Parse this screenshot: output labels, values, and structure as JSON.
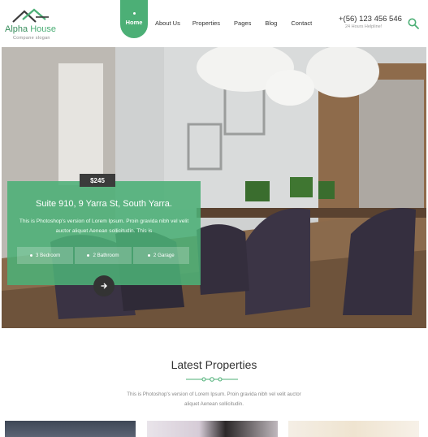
{
  "brand": {
    "name_part1": "Alpha",
    "name_part2": " House",
    "slogan": "Compane slogan"
  },
  "nav": {
    "items": [
      {
        "label": "Home",
        "active": true
      },
      {
        "label": "About Us",
        "active": false
      },
      {
        "label": "Properties",
        "active": false
      },
      {
        "label": "Pages",
        "active": false
      },
      {
        "label": "Blog",
        "active": false
      },
      {
        "label": "Contact",
        "active": false
      }
    ]
  },
  "contact": {
    "phone": "+(56) 123 456 546",
    "helpline": "24 Hours Helpline!"
  },
  "hero": {
    "price": "$245",
    "title": "Suite 910, 9 Yarra St, South Yarra.",
    "description": "This is Photoshop's version  of Lorem Ipsum. Proin gravida nibh vel velit auctor aliquet Aenean sollicitudin. This is",
    "features": [
      "3 Bedroom",
      "2 Bathroom",
      "2 Garage"
    ]
  },
  "latest": {
    "title": "Latest Properties",
    "description": "This is Photoshop's version  of Lorem Ipsum. Proin gravida nibh vel velit auctor aliquet Aenean sollicitudin."
  },
  "icons": {
    "logo": "house-roof-logo-icon",
    "search": "search-icon",
    "next": "chevron-right-icon"
  },
  "colors": {
    "accent": "#4caf76",
    "dark": "#333333"
  }
}
